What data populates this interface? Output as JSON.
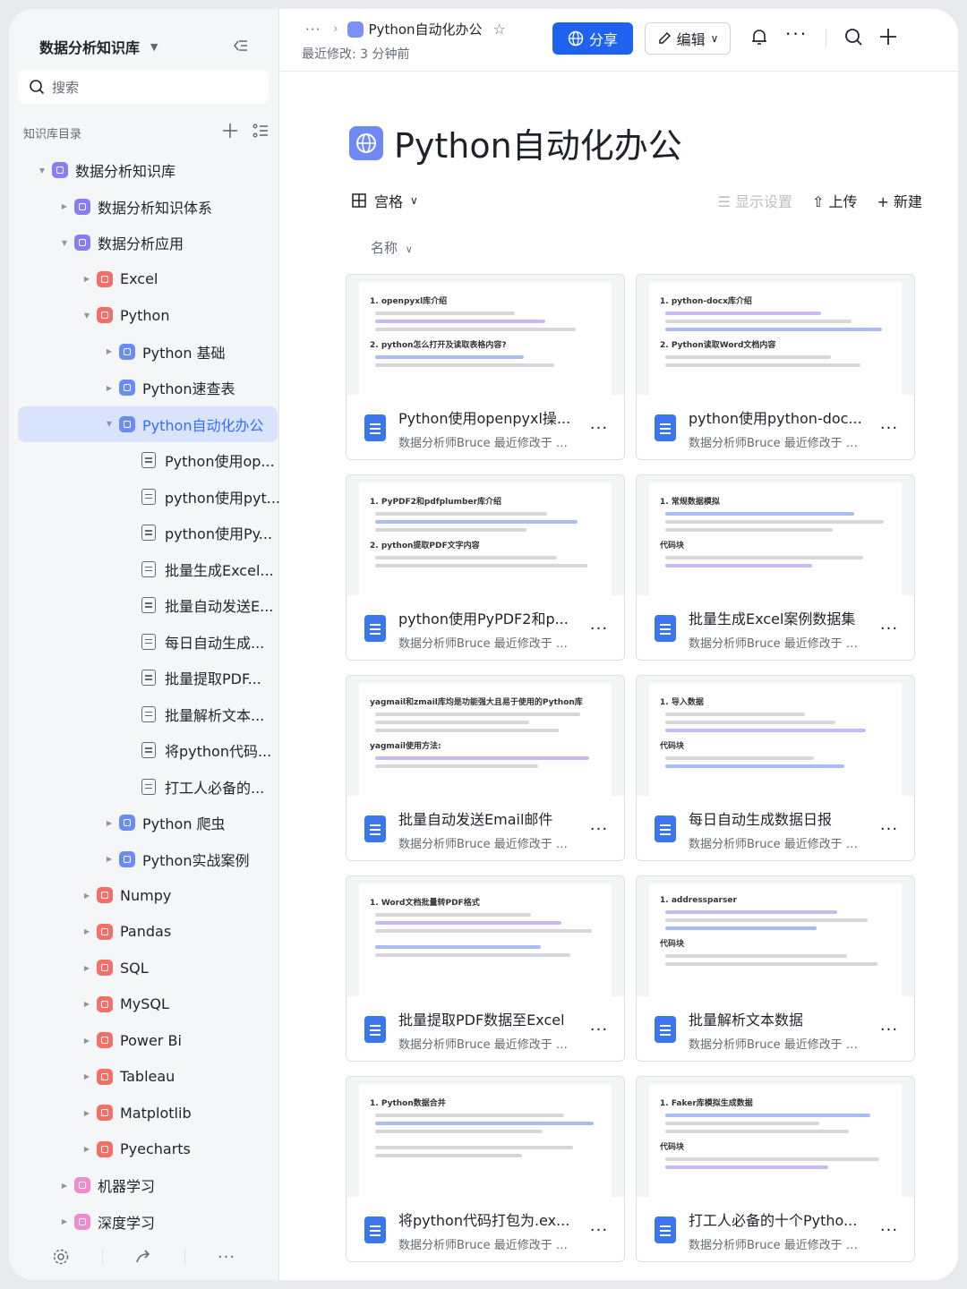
{
  "sidebar": {
    "title": "数据分析知识库",
    "search_placeholder": "搜索",
    "toc_label": "知识库目录",
    "tree": [
      {
        "label": "数据分析知识库",
        "level": 0,
        "expanded": true,
        "icon": "purple"
      },
      {
        "label": "数据分析知识体系",
        "level": 1,
        "expanded": false,
        "icon": "purple"
      },
      {
        "label": "数据分析应用",
        "level": 1,
        "expanded": true,
        "icon": "purple"
      },
      {
        "label": "Excel",
        "level": 2,
        "expanded": false,
        "icon": "red"
      },
      {
        "label": "Python",
        "level": 2,
        "expanded": true,
        "icon": "red"
      },
      {
        "label": "Python 基础",
        "level": 3,
        "expanded": false,
        "icon": "blue"
      },
      {
        "label": "Python速查表",
        "level": 3,
        "expanded": false,
        "icon": "blue"
      },
      {
        "label": "Python自动化办公",
        "level": 3,
        "expanded": true,
        "icon": "blue",
        "active": true
      },
      {
        "label": "Python使用op...",
        "level": 4,
        "icon": "doc"
      },
      {
        "label": "python使用pyt...",
        "level": 4,
        "icon": "doc"
      },
      {
        "label": "python使用Py...",
        "level": 4,
        "icon": "doc"
      },
      {
        "label": "批量生成Excel...",
        "level": 4,
        "icon": "doc"
      },
      {
        "label": "批量自动发送E...",
        "level": 4,
        "icon": "doc"
      },
      {
        "label": "每日自动生成...",
        "level": 4,
        "icon": "doc"
      },
      {
        "label": "批量提取PDF...",
        "level": 4,
        "icon": "doc"
      },
      {
        "label": "批量解析文本...",
        "level": 4,
        "icon": "doc"
      },
      {
        "label": "将python代码...",
        "level": 4,
        "icon": "doc"
      },
      {
        "label": "打工人必备的...",
        "level": 4,
        "icon": "doc"
      },
      {
        "label": "Python 爬虫",
        "level": 3,
        "expanded": false,
        "icon": "blue"
      },
      {
        "label": "Python实战案例",
        "level": 3,
        "expanded": false,
        "icon": "blue"
      },
      {
        "label": "Numpy",
        "level": 2,
        "expanded": false,
        "icon": "red"
      },
      {
        "label": "Pandas",
        "level": 2,
        "expanded": false,
        "icon": "red"
      },
      {
        "label": "SQL",
        "level": 2,
        "expanded": false,
        "icon": "red"
      },
      {
        "label": "MySQL",
        "level": 2,
        "expanded": false,
        "icon": "red"
      },
      {
        "label": "Power Bi",
        "level": 2,
        "expanded": false,
        "icon": "red"
      },
      {
        "label": "Tableau",
        "level": 2,
        "expanded": false,
        "icon": "red"
      },
      {
        "label": "Matplotlib",
        "level": 2,
        "expanded": false,
        "icon": "red"
      },
      {
        "label": "Pyecharts",
        "level": 2,
        "expanded": false,
        "icon": "red"
      },
      {
        "label": "机器学习",
        "level": 1,
        "expanded": false,
        "icon": "pink"
      },
      {
        "label": "深度学习",
        "level": 1,
        "expanded": false,
        "icon": "pink"
      }
    ]
  },
  "header": {
    "breadcrumb_ellipsis": "···",
    "breadcrumb_current": "Python自动化办公",
    "modified": "最近修改: 3 分钟前",
    "share_label": "分享",
    "edit_label": "编辑"
  },
  "main": {
    "title": "Python自动化办公",
    "view_label": "宫格",
    "display_settings": "显示设置",
    "upload": "上传",
    "new": "新建",
    "sort_label": "名称",
    "cards": [
      {
        "name": "Python使用openpyxl操...",
        "meta": "数据分析师Bruce 最近修改于 今...",
        "preview_title": "1. openpyxl库介绍",
        "preview_sub": "2. python怎么打开及读取表格内容?"
      },
      {
        "name": "python使用python-doc...",
        "meta": "数据分析师Bruce 最近修改于 今...",
        "preview_title": "1. python-docx库介绍",
        "preview_sub": "2. Python读取Word文档内容"
      },
      {
        "name": "python使用PyPDF2和p...",
        "meta": "数据分析师Bruce 最近修改于 今...",
        "preview_title": "1. PyPDF2和pdfplumber库介绍",
        "preview_sub": "2. python提取PDF文字内容"
      },
      {
        "name": "批量生成Excel案例数据集",
        "meta": "数据分析师Bruce 最近修改于 今...",
        "preview_title": "1. 常规数据模拟",
        "preview_sub": "代码块"
      },
      {
        "name": "批量自动发送Email邮件",
        "meta": "数据分析师Bruce 最近修改于 今...",
        "preview_title": "yagmail和zmail库均是功能强大且易于使用的Python库",
        "preview_sub": "yagmail使用方法:"
      },
      {
        "name": "每日自动生成数据日报",
        "meta": "数据分析师Bruce 最近修改于 今...",
        "preview_title": "1. 导入数据",
        "preview_sub": "代码块"
      },
      {
        "name": "批量提取PDF数据至Excel",
        "meta": "数据分析师Bruce 最近修改于 今...",
        "preview_title": "1. Word文档批量转PDF格式",
        "preview_sub": ""
      },
      {
        "name": "批量解析文本数据",
        "meta": "数据分析师Bruce 最近修改于 今...",
        "preview_title": "1. addressparser",
        "preview_sub": "代码块"
      },
      {
        "name": "将python代码打包为.ex...",
        "meta": "数据分析师Bruce 最近修改于 今...",
        "preview_title": "1. Python数据合并",
        "preview_sub": ""
      },
      {
        "name": "打工人必备的十个Pytho...",
        "meta": "数据分析师Bruce 最近修改于 今...",
        "preview_title": "1. Faker库模拟生成数据",
        "preview_sub": "代码块"
      }
    ]
  },
  "colors": {
    "accent": "#1f62f0",
    "active_bg": "#d9e3fb"
  }
}
